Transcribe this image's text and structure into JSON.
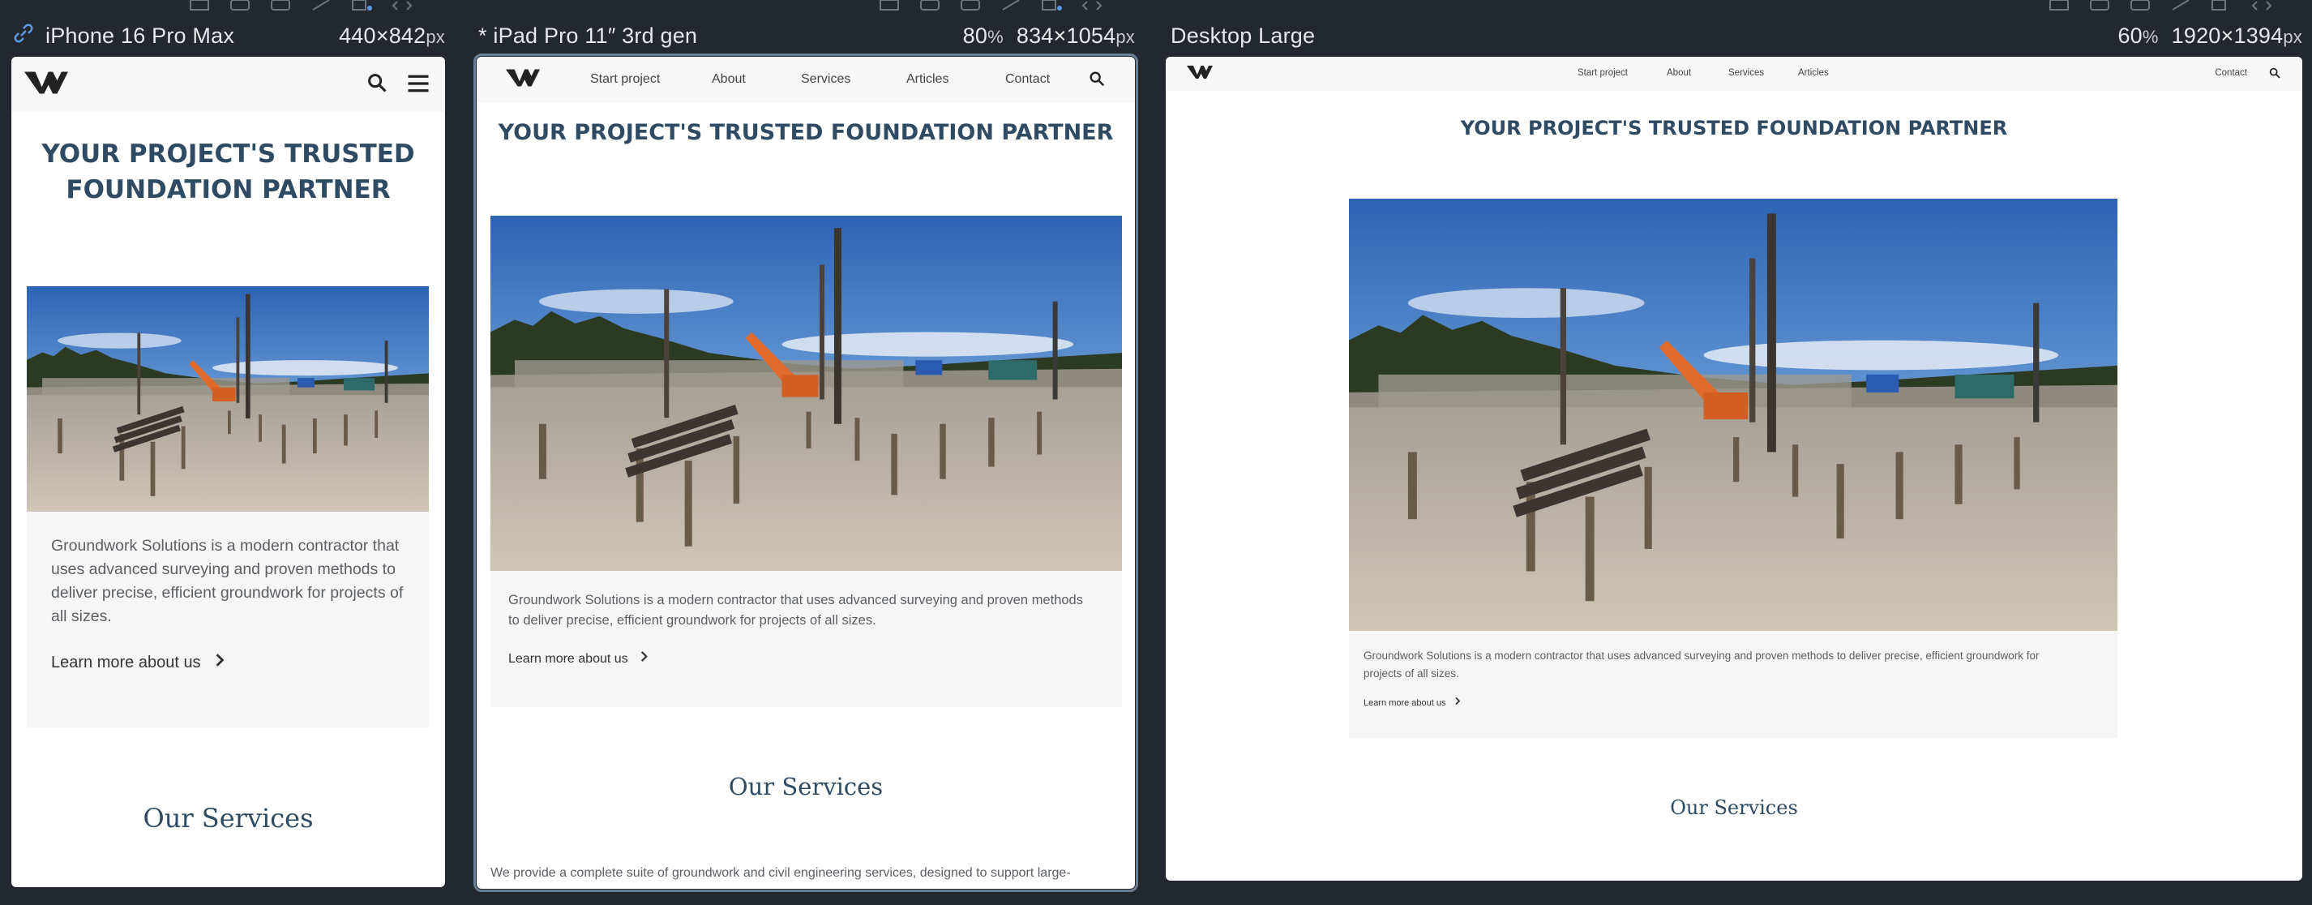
{
  "viewports": [
    {
      "name": "iPhone 16 Pro Max",
      "zoom": "",
      "width": "440",
      "height": "842",
      "unit": "px",
      "modified": false,
      "selected": false
    },
    {
      "name": "* iPad Pro 11″ 3rd gen",
      "zoom": "80",
      "width": "834",
      "height": "1054",
      "unit": "px",
      "modified": true,
      "selected": true
    },
    {
      "name": "Desktop Large",
      "zoom": "60",
      "width": "1920",
      "height": "1394",
      "unit": "px",
      "modified": false,
      "selected": false
    }
  ],
  "zoom_suffix": "%",
  "dims_sep": "×",
  "site": {
    "nav": [
      "Start project",
      "About",
      "Services",
      "Articles",
      "Contact"
    ],
    "headline": "YOUR PROJECT'S TRUSTED FOUNDATION PARTNER",
    "headline_line1": "YOUR PROJECT'S TRUSTED",
    "headline_line2": "FOUNDATION PARTNER",
    "intro": "Groundwork Solutions is a modern contractor that uses advanced surveying and proven methods to deliver precise, efficient groundwork for projects of all sizes.",
    "intro_ipad_l1": "Groundwork Solutions is a modern contractor that uses advanced surveying and proven methods",
    "intro_ipad_l2": "to deliver precise, efficient groundwork for projects of all sizes.",
    "intro_desk_l1": "Groundwork Solutions is a modern contractor that uses advanced surveying and proven methods to deliver precise, efficient groundwork for",
    "intro_desk_l2": "projects of all sizes.",
    "learn_more": "Learn more about us",
    "services_title": "Our Services",
    "services_intro": "We provide a complete suite of groundwork and civil engineering services, designed to support large-"
  },
  "icons": {
    "link": "link-icon",
    "search": "search-icon",
    "menu": "hamburger-menu-icon",
    "chevron": "chevron-right-icon",
    "logo": "company-logo"
  }
}
